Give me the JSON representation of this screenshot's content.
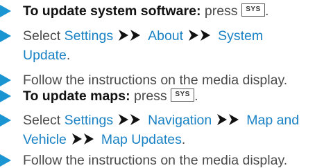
{
  "colors": {
    "accent": "#1b94d2",
    "link": "#1a82c4",
    "text": "#4a4a4a"
  },
  "steps": [
    {
      "heading": "To update system software:",
      "after": "press",
      "key": "SYS",
      "end": "."
    },
    {
      "prefix": "Select",
      "path": [
        "Settings",
        "About",
        "System"
      ],
      "path2": [
        "Update"
      ],
      "end": "."
    },
    {
      "text": "Follow the instructions on the media display."
    },
    {
      "heading": "To update maps:",
      "after": "press",
      "key": "SYS",
      "end": "."
    },
    {
      "prefix": "Select",
      "path": [
        "Settings",
        "Navigation",
        "Map and"
      ],
      "path2": [
        "Vehicle",
        "Map Updates"
      ],
      "end": "."
    },
    {
      "text": "Follow the instructions on the media display."
    }
  ]
}
